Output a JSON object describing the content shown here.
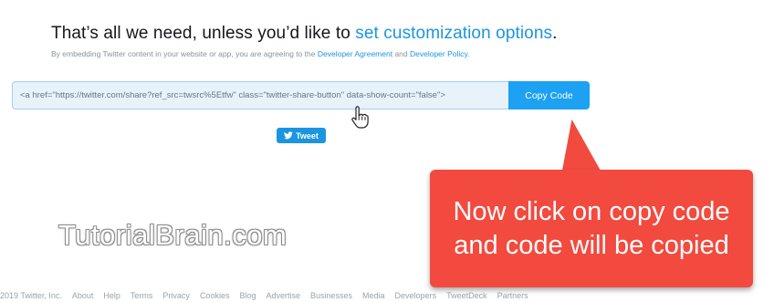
{
  "heading": {
    "text": "That’s all we need, unless you’d like to ",
    "link": "set customization options",
    "suffix": "."
  },
  "subtext": {
    "text": "By embedding Twitter content in your website or app, you are agreeing to the ",
    "link1": "Developer Agreement",
    "and": " and ",
    "link2": "Developer Policy",
    "suffix": "."
  },
  "embed": {
    "code": "<a href=\"https://twitter.com/share?ref_src=twsrc%5Etfw\" class=\"twitter-share-button\" data-show-count=\"false\">",
    "copy_label": "Copy Code"
  },
  "tweet_button": {
    "label": "Tweet",
    "icon": "twitter-bird-icon",
    "color": "#1b95e0"
  },
  "watermark": "TutorialBrain.com",
  "callout": {
    "text": "Now click on copy code and code will be copied",
    "color": "#f24a3f"
  },
  "footer": {
    "copyright": "2019 Twitter, Inc.",
    "links": [
      "About",
      "Help",
      "Terms",
      "Privacy",
      "Cookies",
      "Blog",
      "Advertise",
      "Businesses",
      "Media",
      "Developers",
      "TweetDeck",
      "Partners"
    ]
  },
  "colors": {
    "accent": "#1da1f2",
    "link": "#1b95e0"
  }
}
